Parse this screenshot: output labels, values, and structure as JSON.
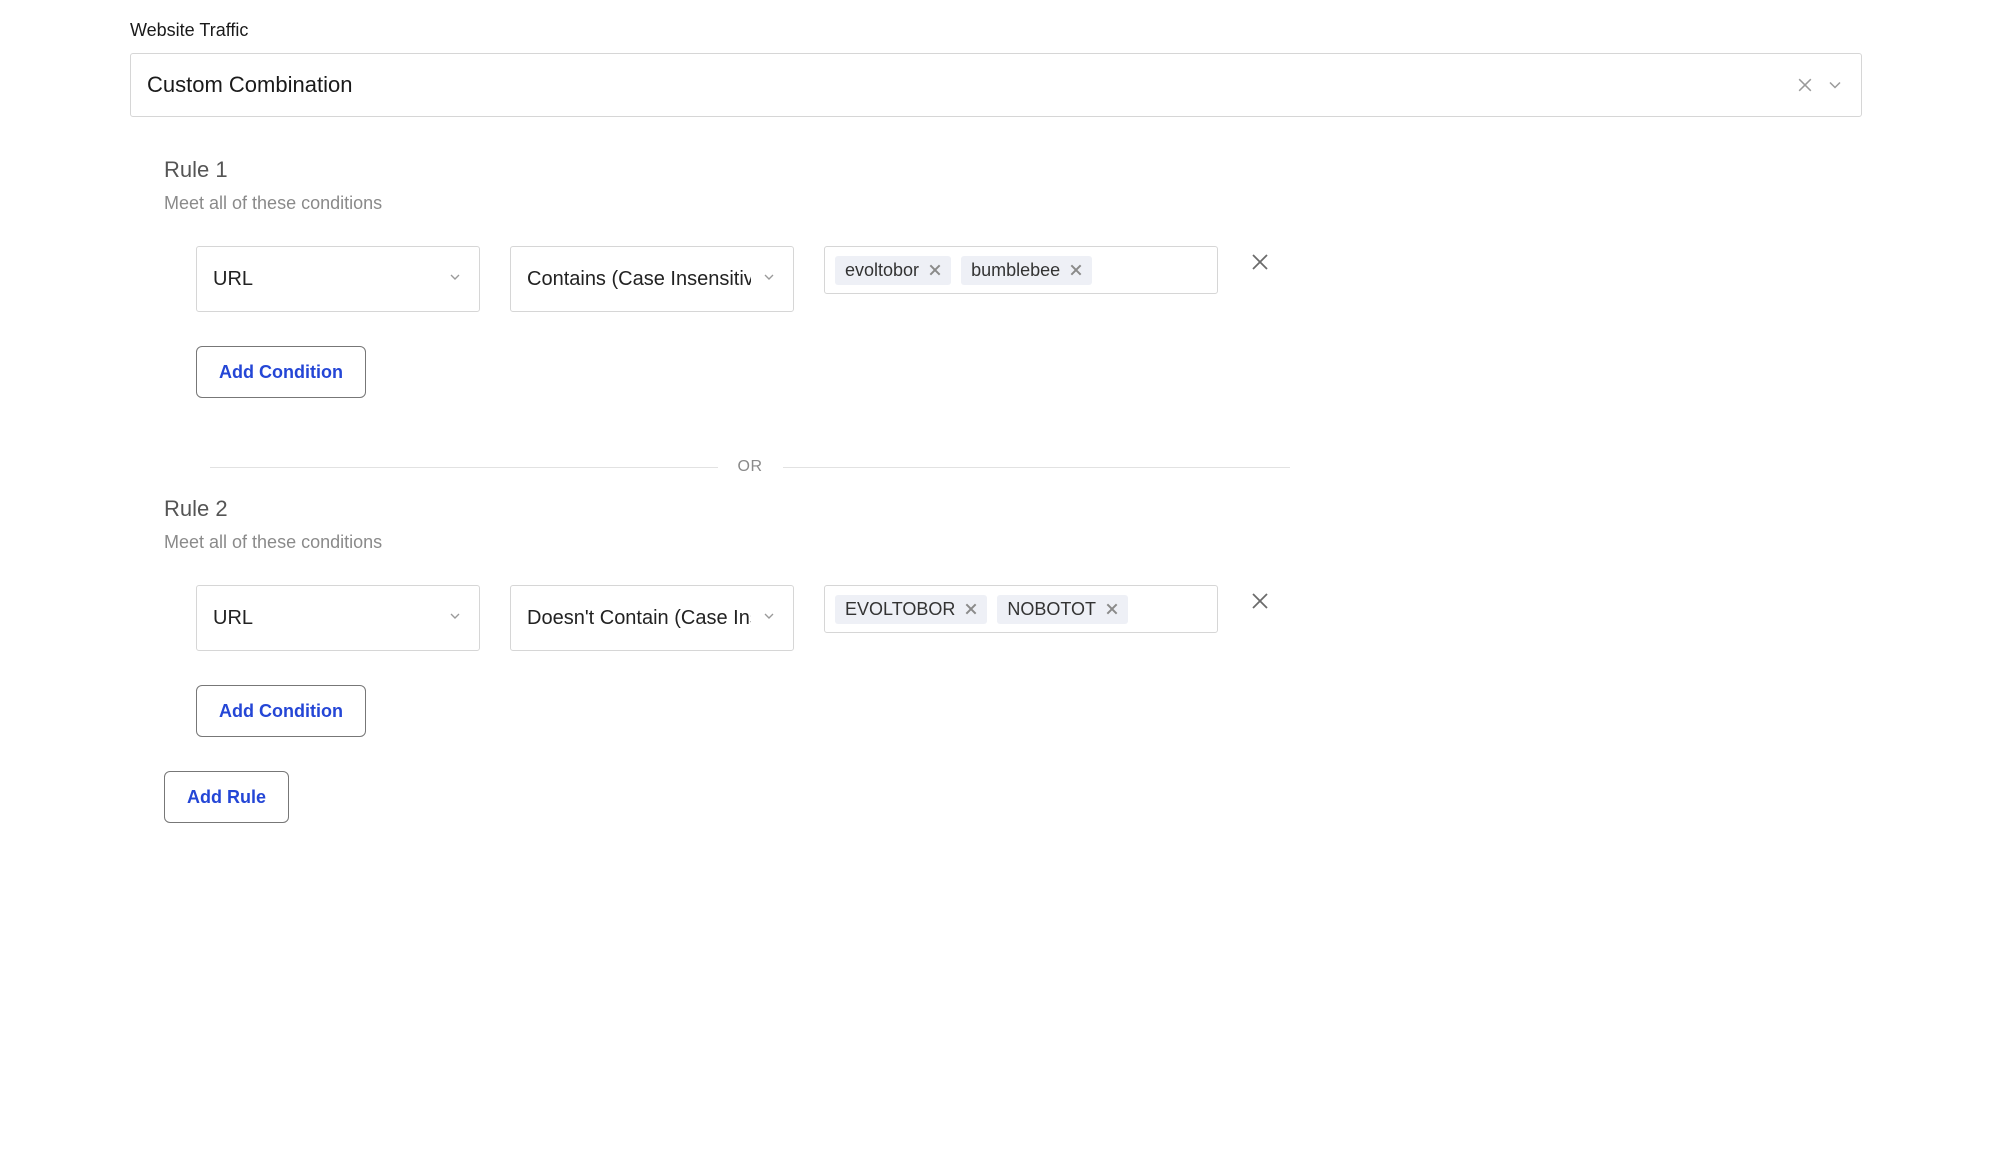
{
  "header": {
    "section_label": "Website Traffic",
    "combination_value": "Custom Combination"
  },
  "divider": {
    "or_label": "OR"
  },
  "buttons": {
    "add_condition": "Add Condition",
    "add_rule": "Add Rule"
  },
  "rules": [
    {
      "title": "Rule 1",
      "subtitle": "Meet all of these conditions",
      "condition": {
        "field": "URL",
        "operator": "Contains (Case Insensitive)",
        "tags": [
          "evoltobor",
          "bumblebee"
        ]
      }
    },
    {
      "title": "Rule 2",
      "subtitle": "Meet all of these conditions",
      "condition": {
        "field": "URL",
        "operator": "Doesn't Contain (Case Insensitive)",
        "tags": [
          "EVOLTOBOR",
          "NOBOTOT"
        ]
      }
    }
  ]
}
